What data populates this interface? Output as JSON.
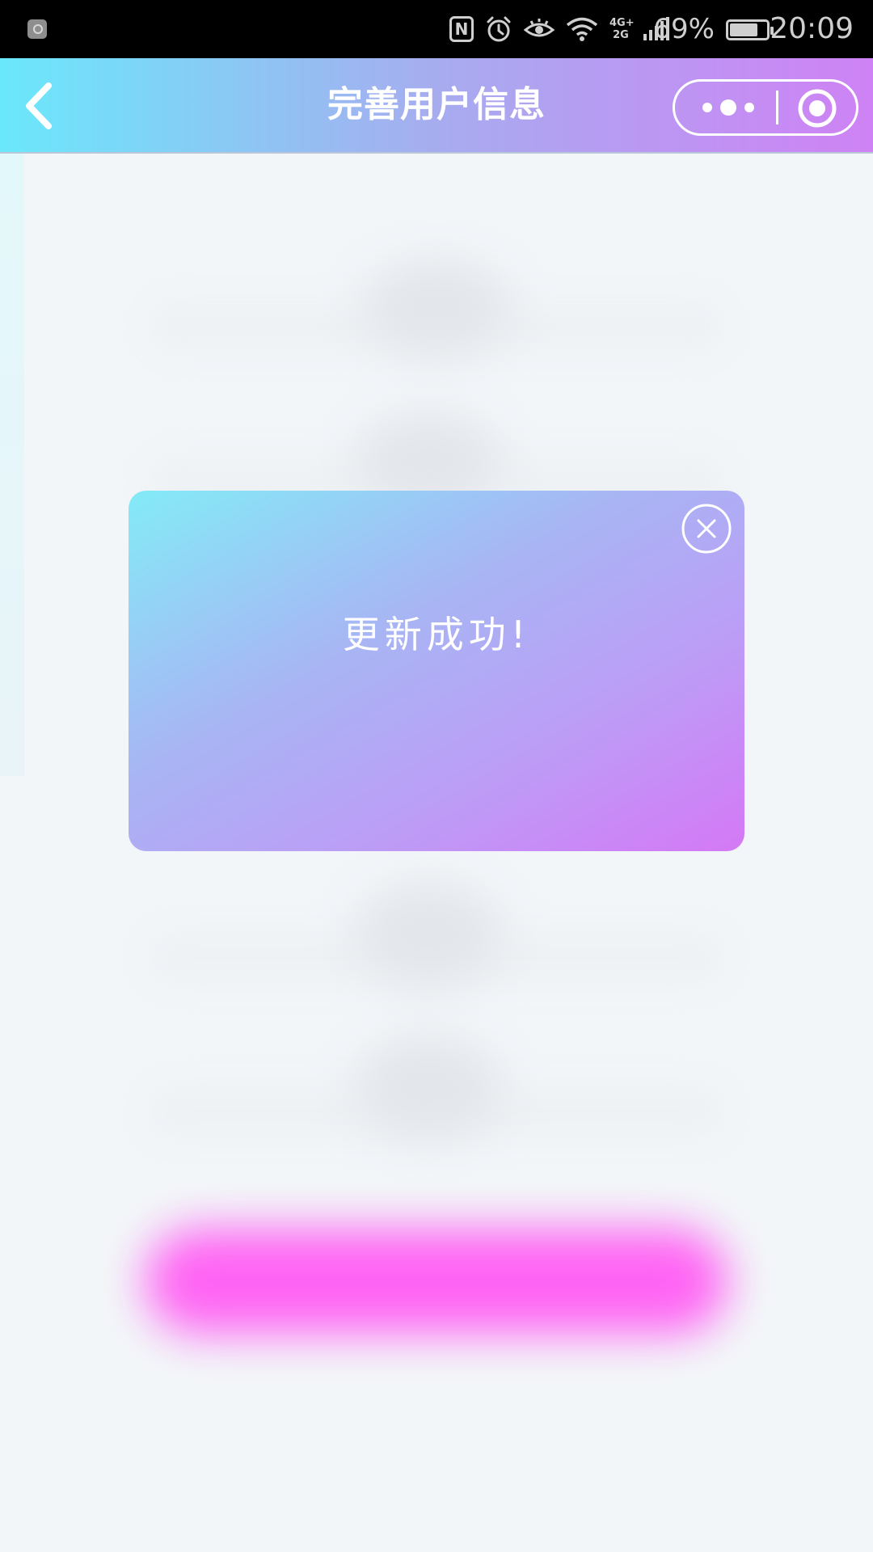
{
  "status_bar": {
    "network": "4G+ 2G",
    "battery_percent": "69%",
    "time": "20:09"
  },
  "nav": {
    "title": "完善用户信息"
  },
  "modal": {
    "message": "更新成功!"
  },
  "colors": {
    "nav_gradient_start": "#6ae8fb",
    "nav_gradient_end": "#cf82f5",
    "modal_gradient_start": "#83ebf7",
    "modal_gradient_end": "#d478f5",
    "submit_button": "#ff5cf3"
  }
}
